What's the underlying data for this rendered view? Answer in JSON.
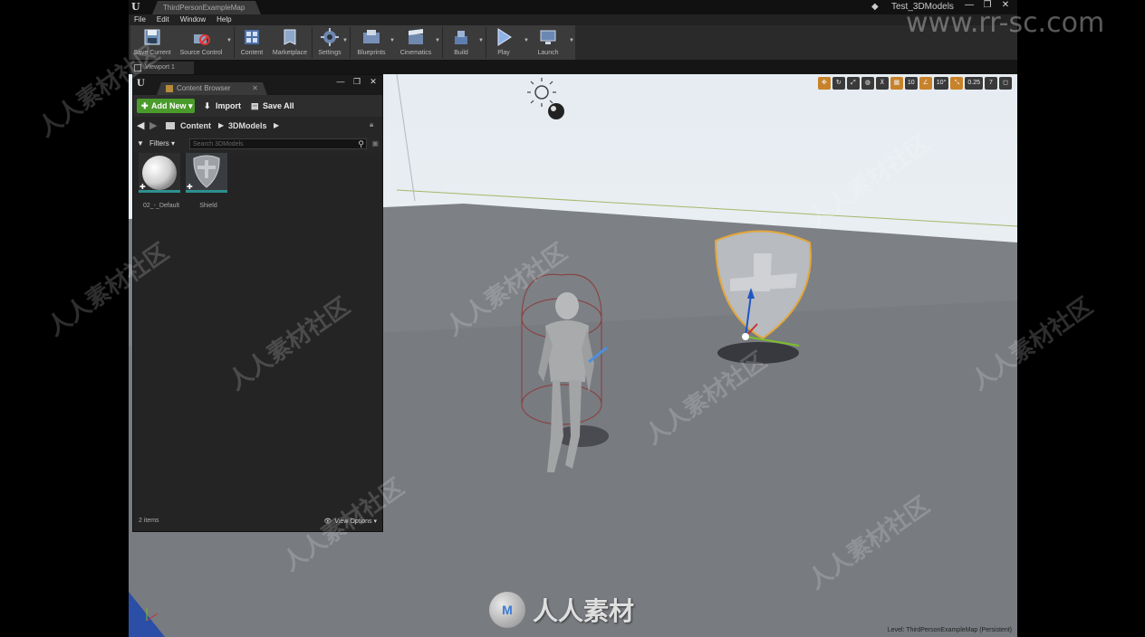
{
  "titlebar": {
    "document_tab": "ThirdPersonExampleMap",
    "project_name": "Test_3DModels",
    "win_min": "—",
    "win_max": "❐",
    "win_close": "✕"
  },
  "menu": {
    "items": [
      "File",
      "Edit",
      "Window",
      "Help"
    ]
  },
  "toolbar": {
    "buttons": [
      {
        "label": "Save Current",
        "icon": "save-icon"
      },
      {
        "label": "Source Control",
        "icon": "source-control-icon"
      },
      {
        "label": "Content",
        "icon": "content-icon"
      },
      {
        "label": "Marketplace",
        "icon": "marketplace-icon"
      },
      {
        "label": "Settings",
        "icon": "settings-icon"
      },
      {
        "label": "Blueprints",
        "icon": "blueprints-icon"
      },
      {
        "label": "Cinematics",
        "icon": "cinematics-icon"
      },
      {
        "label": "Build",
        "icon": "build-icon"
      },
      {
        "label": "Play",
        "icon": "play-icon"
      },
      {
        "label": "Launch",
        "icon": "launch-icon"
      }
    ]
  },
  "viewport": {
    "tab_label": "Viewport 1",
    "tools": {
      "grid_snap_value": "10",
      "rotation_snap_value": "10°",
      "scale_snap_value": "0.25",
      "camera_speed": "7"
    },
    "level_label": "Level:  ThirdPersonExampleMap (Persistent)"
  },
  "content_browser": {
    "tab_label": "Content Browser",
    "add_new_label": "Add New",
    "import_label": "Import",
    "save_all_label": "Save All",
    "path": [
      "Content",
      "3DModels"
    ],
    "filters_label": "Filters",
    "search_placeholder": "Search 3DModels",
    "assets": [
      {
        "name": "02_-_Default",
        "type": "material"
      },
      {
        "name": "Shield",
        "type": "static-mesh"
      }
    ],
    "item_count": "2 items",
    "view_options_label": "View Options"
  },
  "watermark": {
    "url": "www.rr-sc.com",
    "logo_text": "人人素材",
    "tile_text": "人人素材社区"
  },
  "colors": {
    "accent_green": "#4a9a2c",
    "snap_orange": "#c8822a",
    "asset_underline": "#2e8f8f",
    "selection_outline": "#e2a63a"
  }
}
